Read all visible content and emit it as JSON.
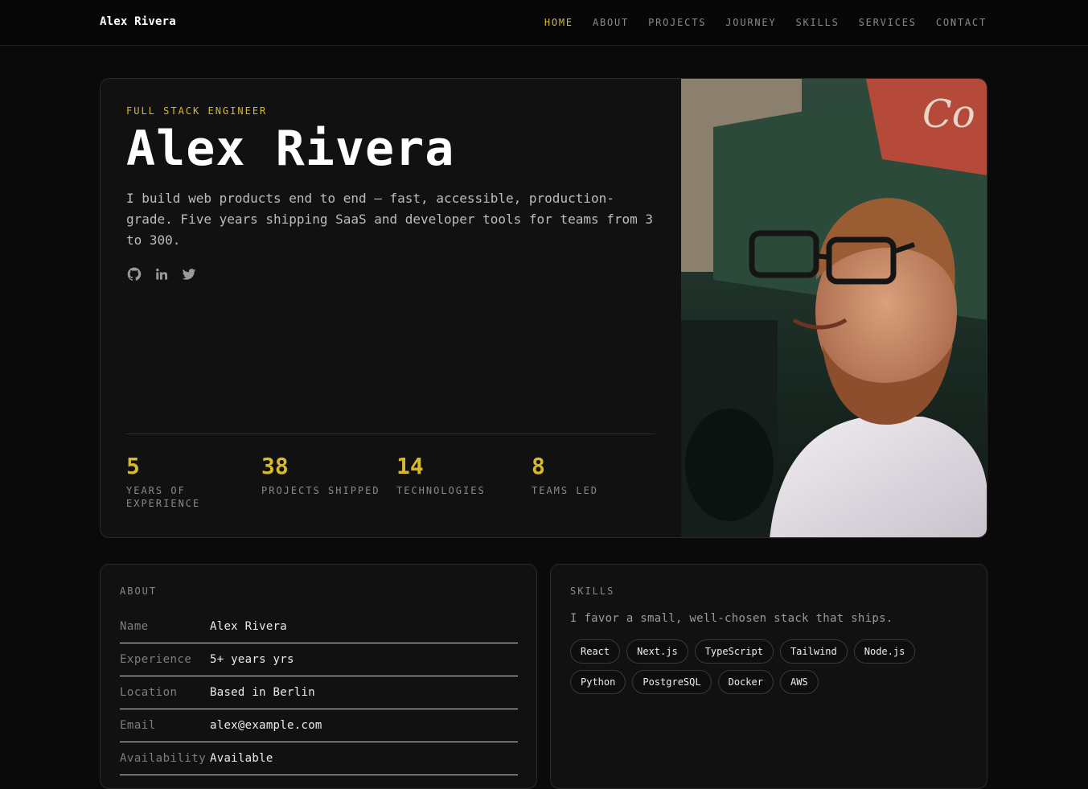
{
  "nav": {
    "brand": "Alex Rivera",
    "links": [
      {
        "label": "HOME",
        "active": true
      },
      {
        "label": "ABOUT"
      },
      {
        "label": "PROJECTS"
      },
      {
        "label": "JOURNEY"
      },
      {
        "label": "SKILLS"
      },
      {
        "label": "SERVICES"
      },
      {
        "label": "CONTACT"
      }
    ]
  },
  "hero": {
    "eyebrow": "FULL STACK ENGINEER",
    "name": "Alex Rivera",
    "bio": "I build web products end to end — fast, accessible, production-grade. Five years shipping SaaS and developer tools for teams from 3 to 300.",
    "socials": [
      "github-icon",
      "linkedin-icon",
      "twitter-icon"
    ],
    "stats": [
      {
        "value": "5",
        "label": "YEARS OF EXPERIENCE"
      },
      {
        "value": "38",
        "label": "PROJECTS SHIPPED"
      },
      {
        "value": "14",
        "label": "TECHNOLOGIES"
      },
      {
        "value": "8",
        "label": "TEAMS LED"
      }
    ]
  },
  "about": {
    "title": "ABOUT",
    "rows": [
      {
        "label": "Name",
        "value": "Alex Rivera"
      },
      {
        "label": "Experience",
        "value": "5+ years yrs"
      },
      {
        "label": "Location",
        "value": "Based in Berlin"
      },
      {
        "label": "Email",
        "value": "alex@example.com"
      },
      {
        "label": "Availability",
        "value": "Available"
      }
    ]
  },
  "skills": {
    "title": "SKILLS",
    "description": "I favor a small, well-chosen stack that ships.",
    "chips": [
      "React",
      "Next.js",
      "TypeScript",
      "Tailwind",
      "Node.js",
      "Python",
      "PostgreSQL",
      "Docker",
      "AWS"
    ]
  },
  "colors": {
    "accent": "#d6b92c",
    "background": "#0a0a0a",
    "card": "#111111"
  }
}
